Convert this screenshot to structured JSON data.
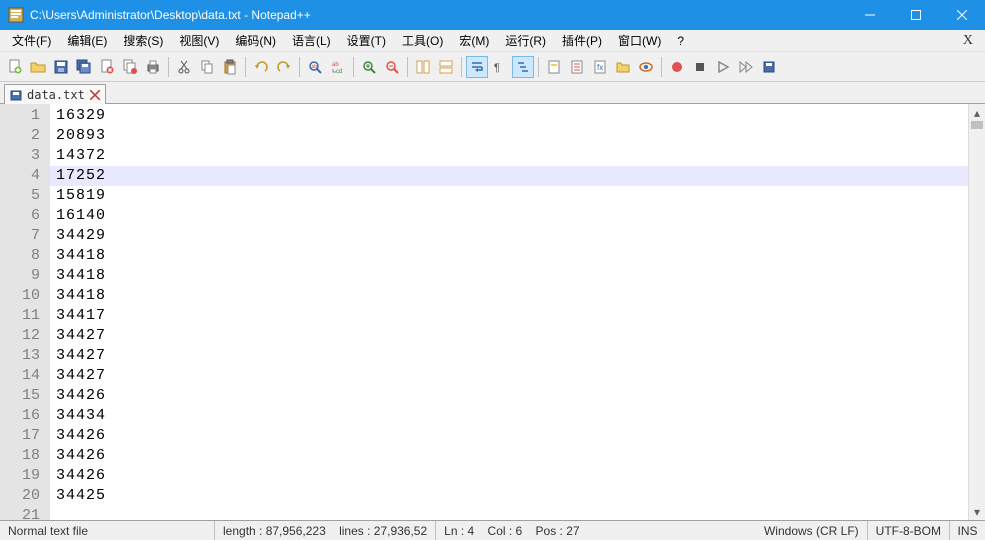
{
  "window": {
    "title": "C:\\Users\\Administrator\\Desktop\\data.txt - Notepad++"
  },
  "menu": {
    "items": [
      "文件(F)",
      "编辑(E)",
      "搜索(S)",
      "视图(V)",
      "编码(N)",
      "语言(L)",
      "设置(T)",
      "工具(O)",
      "宏(M)",
      "运行(R)",
      "插件(P)",
      "窗口(W)",
      "?"
    ]
  },
  "tab": {
    "name": "data.txt"
  },
  "editor": {
    "current_line_index": 3,
    "lines": [
      "16329",
      "20893",
      "14372",
      "17252",
      "15819",
      "16140",
      "34429",
      "34418",
      "34418",
      "34418",
      "34417",
      "34427",
      "34427",
      "34427",
      "34426",
      "34434",
      "34426",
      "34426",
      "34426",
      "34425"
    ],
    "last_visible_line_number": "21"
  },
  "status": {
    "filetype": "Normal text file",
    "length": "length : 87,956,223    lines : 27,936,52",
    "pos": "Ln : 4    Col : 6    Pos : 27",
    "eol": "Windows (CR LF)",
    "enc": "UTF-8-BOM",
    "mode": "INS"
  }
}
